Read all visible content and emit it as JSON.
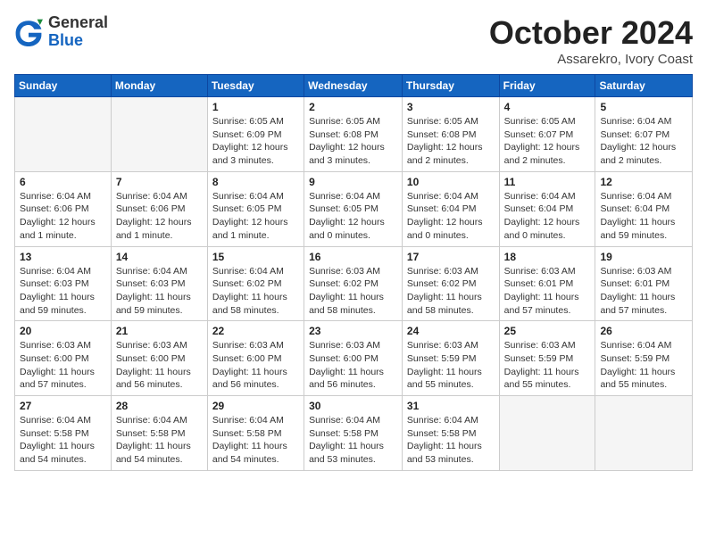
{
  "header": {
    "logo_general": "General",
    "logo_blue": "Blue",
    "month": "October 2024",
    "location": "Assarekro, Ivory Coast"
  },
  "weekdays": [
    "Sunday",
    "Monday",
    "Tuesday",
    "Wednesday",
    "Thursday",
    "Friday",
    "Saturday"
  ],
  "weeks": [
    [
      {
        "day": "",
        "content": ""
      },
      {
        "day": "",
        "content": ""
      },
      {
        "day": "1",
        "content": "Sunrise: 6:05 AM\nSunset: 6:09 PM\nDaylight: 12 hours and 3 minutes."
      },
      {
        "day": "2",
        "content": "Sunrise: 6:05 AM\nSunset: 6:08 PM\nDaylight: 12 hours and 3 minutes."
      },
      {
        "day": "3",
        "content": "Sunrise: 6:05 AM\nSunset: 6:08 PM\nDaylight: 12 hours and 2 minutes."
      },
      {
        "day": "4",
        "content": "Sunrise: 6:05 AM\nSunset: 6:07 PM\nDaylight: 12 hours and 2 minutes."
      },
      {
        "day": "5",
        "content": "Sunrise: 6:04 AM\nSunset: 6:07 PM\nDaylight: 12 hours and 2 minutes."
      }
    ],
    [
      {
        "day": "6",
        "content": "Sunrise: 6:04 AM\nSunset: 6:06 PM\nDaylight: 12 hours and 1 minute."
      },
      {
        "day": "7",
        "content": "Sunrise: 6:04 AM\nSunset: 6:06 PM\nDaylight: 12 hours and 1 minute."
      },
      {
        "day": "8",
        "content": "Sunrise: 6:04 AM\nSunset: 6:05 PM\nDaylight: 12 hours and 1 minute."
      },
      {
        "day": "9",
        "content": "Sunrise: 6:04 AM\nSunset: 6:05 PM\nDaylight: 12 hours and 0 minutes."
      },
      {
        "day": "10",
        "content": "Sunrise: 6:04 AM\nSunset: 6:04 PM\nDaylight: 12 hours and 0 minutes."
      },
      {
        "day": "11",
        "content": "Sunrise: 6:04 AM\nSunset: 6:04 PM\nDaylight: 12 hours and 0 minutes."
      },
      {
        "day": "12",
        "content": "Sunrise: 6:04 AM\nSunset: 6:04 PM\nDaylight: 11 hours and 59 minutes."
      }
    ],
    [
      {
        "day": "13",
        "content": "Sunrise: 6:04 AM\nSunset: 6:03 PM\nDaylight: 11 hours and 59 minutes."
      },
      {
        "day": "14",
        "content": "Sunrise: 6:04 AM\nSunset: 6:03 PM\nDaylight: 11 hours and 59 minutes."
      },
      {
        "day": "15",
        "content": "Sunrise: 6:04 AM\nSunset: 6:02 PM\nDaylight: 11 hours and 58 minutes."
      },
      {
        "day": "16",
        "content": "Sunrise: 6:03 AM\nSunset: 6:02 PM\nDaylight: 11 hours and 58 minutes."
      },
      {
        "day": "17",
        "content": "Sunrise: 6:03 AM\nSunset: 6:02 PM\nDaylight: 11 hours and 58 minutes."
      },
      {
        "day": "18",
        "content": "Sunrise: 6:03 AM\nSunset: 6:01 PM\nDaylight: 11 hours and 57 minutes."
      },
      {
        "day": "19",
        "content": "Sunrise: 6:03 AM\nSunset: 6:01 PM\nDaylight: 11 hours and 57 minutes."
      }
    ],
    [
      {
        "day": "20",
        "content": "Sunrise: 6:03 AM\nSunset: 6:00 PM\nDaylight: 11 hours and 57 minutes."
      },
      {
        "day": "21",
        "content": "Sunrise: 6:03 AM\nSunset: 6:00 PM\nDaylight: 11 hours and 56 minutes."
      },
      {
        "day": "22",
        "content": "Sunrise: 6:03 AM\nSunset: 6:00 PM\nDaylight: 11 hours and 56 minutes."
      },
      {
        "day": "23",
        "content": "Sunrise: 6:03 AM\nSunset: 6:00 PM\nDaylight: 11 hours and 56 minutes."
      },
      {
        "day": "24",
        "content": "Sunrise: 6:03 AM\nSunset: 5:59 PM\nDaylight: 11 hours and 55 minutes."
      },
      {
        "day": "25",
        "content": "Sunrise: 6:03 AM\nSunset: 5:59 PM\nDaylight: 11 hours and 55 minutes."
      },
      {
        "day": "26",
        "content": "Sunrise: 6:04 AM\nSunset: 5:59 PM\nDaylight: 11 hours and 55 minutes."
      }
    ],
    [
      {
        "day": "27",
        "content": "Sunrise: 6:04 AM\nSunset: 5:58 PM\nDaylight: 11 hours and 54 minutes."
      },
      {
        "day": "28",
        "content": "Sunrise: 6:04 AM\nSunset: 5:58 PM\nDaylight: 11 hours and 54 minutes."
      },
      {
        "day": "29",
        "content": "Sunrise: 6:04 AM\nSunset: 5:58 PM\nDaylight: 11 hours and 54 minutes."
      },
      {
        "day": "30",
        "content": "Sunrise: 6:04 AM\nSunset: 5:58 PM\nDaylight: 11 hours and 53 minutes."
      },
      {
        "day": "31",
        "content": "Sunrise: 6:04 AM\nSunset: 5:58 PM\nDaylight: 11 hours and 53 minutes."
      },
      {
        "day": "",
        "content": ""
      },
      {
        "day": "",
        "content": ""
      }
    ]
  ]
}
